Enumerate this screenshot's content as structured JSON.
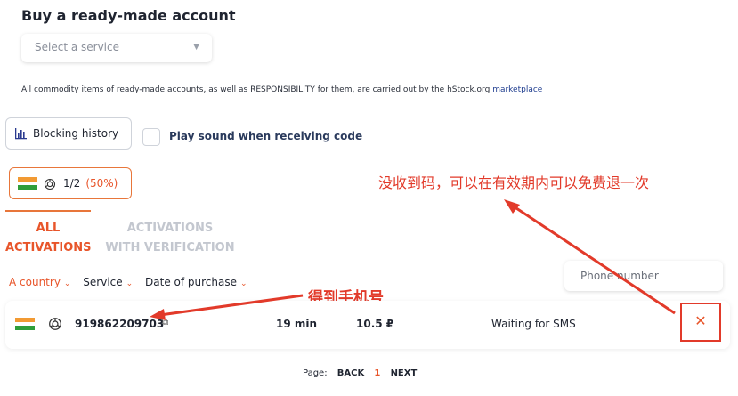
{
  "buy": {
    "title": "Buy a ready-made account",
    "select_placeholder": "Select a service",
    "notice_text": "All commodity items of ready-made accounts, as well as RESPONSIBILITY for them, are carried out by the hStock.org",
    "notice_link": "marketplace"
  },
  "toolbar": {
    "history_label": "Blocking history",
    "sound_label": "Play sound when receiving code"
  },
  "country_pill": {
    "count": "1/2",
    "percent": "(50%)"
  },
  "tabs": {
    "all_line1": "ALL",
    "all_line2": "ACTIVATIONS",
    "ver_line1": "ACTIVATIONS",
    "ver_line2": "WITH VERIFICATION"
  },
  "filters": {
    "country": "A country",
    "service": "Service",
    "date": "Date of purchase"
  },
  "phone_placeholder": "Phone number",
  "activation": {
    "number": "919862209703",
    "time": "19 min",
    "price": "10.5 ₽",
    "status": "Waiting for SMS",
    "cancel_icon": "✕"
  },
  "annotations": {
    "refund_note": "没收到码，可以在有效期内可以免费退一次",
    "got_number": "得到手机号"
  },
  "pager": {
    "label": "Page:",
    "back": "BACK",
    "current": "1",
    "next": "NEXT"
  },
  "colors": {
    "accent": "#e8552a",
    "annotation": "#e23a2a",
    "navy": "#2a3a5c"
  }
}
